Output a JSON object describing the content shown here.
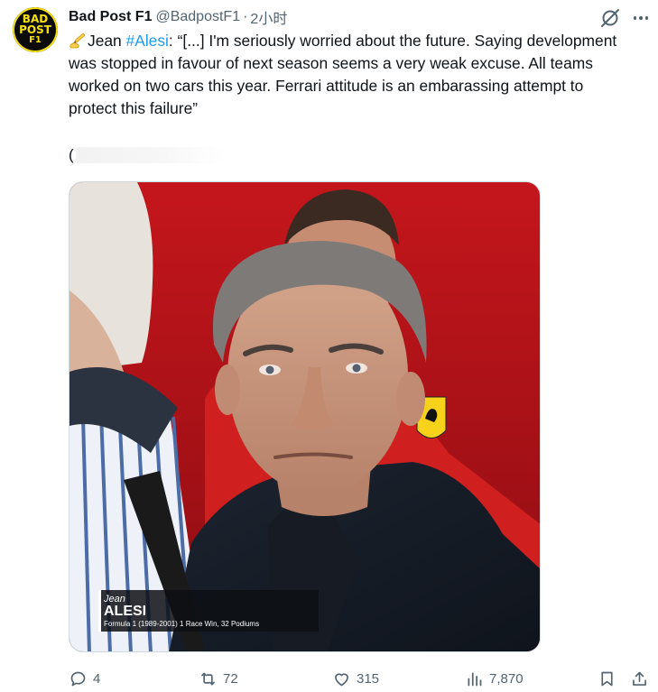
{
  "avatar": {
    "line1": "BAD",
    "line2": "POST",
    "line3": "F1",
    "color": "#f5e012"
  },
  "author": {
    "name": "Bad Post F1",
    "handle": "@BadpostF1",
    "separator": "·",
    "time": "2小时"
  },
  "tweet": {
    "prefix": "Jean ",
    "hashtag": "#Alesi",
    "body": ": “[...] I'm seriously worried about the future. Saying development was stopped in favour of next season seems a very weak excuse. All teams worked on two cars this year. Ferrari attitude is an embarassing attempt to protect this failure”",
    "paren": "("
  },
  "media": {
    "caption_first": "Jean",
    "caption_last": "ALESI",
    "caption_detail": "Formula 1 (1989-2001) 1 Race Win, 32 Podiums"
  },
  "actions": {
    "replies": "4",
    "reposts": "72",
    "likes": "315",
    "views": "7,870"
  },
  "colors": {
    "link": "#1d9bf0",
    "muted": "#536471",
    "text": "#0f1419"
  },
  "icons": [
    "grok-icon",
    "more-icon",
    "writing-hand-icon",
    "reply-icon",
    "retweet-icon",
    "like-icon",
    "views-icon",
    "bookmark-icon",
    "share-icon"
  ]
}
